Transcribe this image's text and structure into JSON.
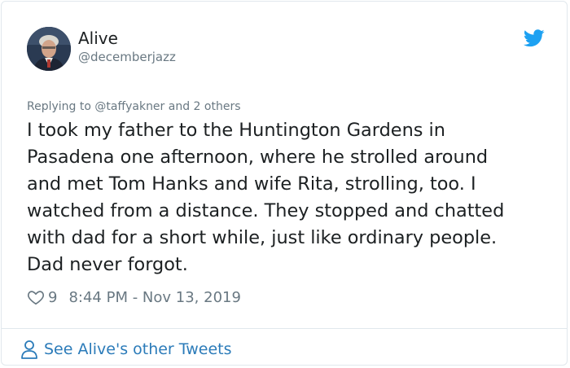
{
  "user": {
    "name": "Alive",
    "handle": "@decemberjazz"
  },
  "tweet": {
    "replying_to": "Replying to @taffyakner and 2 others",
    "lines": [
      "I took my father to the Huntington Gardens in",
      "Pasadena one afternoon, where he strolled around",
      "and met Tom Hanks and wife Rita, strolling, too.  I",
      "watched from a distance.  They stopped and chatted",
      "with dad for a short while, just like ordinary people.",
      "Dad never forgot."
    ],
    "likes": "9",
    "timestamp": "8:44 PM - Nov 13, 2019"
  },
  "footer": {
    "link_text": "See Alive's other Tweets"
  },
  "icons": {
    "brand": "twitter-bird-icon",
    "like": "heart-icon",
    "profile": "person-icon"
  },
  "colors": {
    "text": "#1c2022",
    "secondary": "#697882",
    "link": "#2b7bb9",
    "twitter_blue": "#1da1f2",
    "border": "#e1e8ed"
  }
}
